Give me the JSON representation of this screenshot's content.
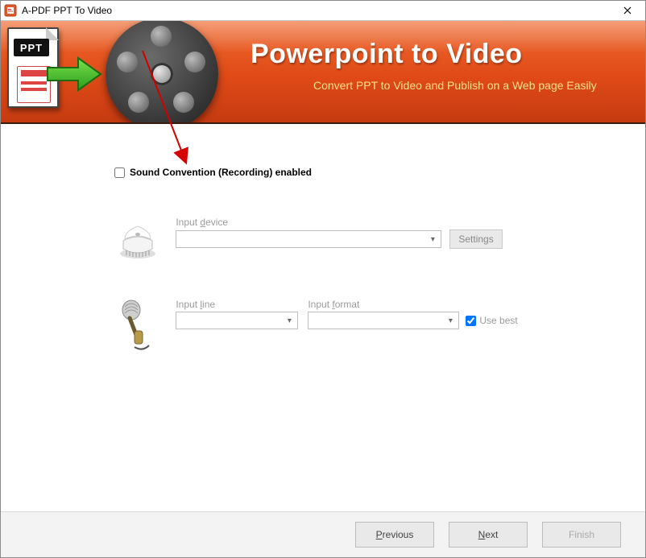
{
  "window": {
    "title": "A-PDF PPT To Video"
  },
  "banner": {
    "title": "Powerpoint to Video",
    "subtitle": "Convert PPT to Video and Publish on a Web page Easily",
    "ppt_badge": "PPT"
  },
  "form": {
    "sound_checkbox_label": "Sound Convention (Recording) enabled",
    "sound_checked": false,
    "input_device": {
      "label_prefix": "Input ",
      "label_ul": "d",
      "label_suffix": "evice",
      "value": "",
      "settings_label": "Settings"
    },
    "input_line": {
      "label_prefix": "Input ",
      "label_ul": "l",
      "label_suffix": "ine",
      "value": ""
    },
    "input_format": {
      "label_prefix": "Input ",
      "label_ul": "f",
      "label_suffix": "ormat",
      "value": ""
    },
    "use_best": {
      "label": "Use best",
      "checked": true
    }
  },
  "footer": {
    "previous_ul": "P",
    "previous_rest": "revious",
    "next_ul": "N",
    "next_rest": "ext",
    "finish": "Finish"
  }
}
